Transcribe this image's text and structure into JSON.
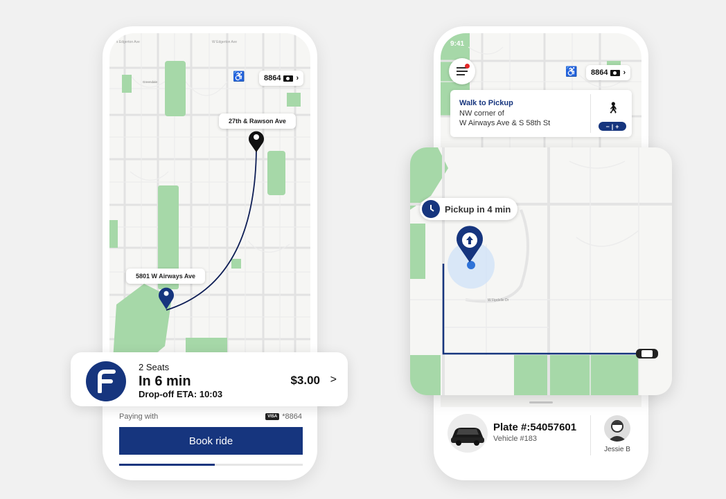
{
  "left_phone": {
    "map_top_labels": [
      "s Edgerton Ave",
      "W Edgerton Ave"
    ],
    "map_place": "Greendale",
    "balance": "8864",
    "destination_label": "27th & Rawson Ave",
    "origin_label": "5801 W Airways Ave",
    "ride": {
      "seats": "2 Seats",
      "eta": "In 6 min",
      "dropoff": "Drop-off ETA: 10:03",
      "price": "$3.00",
      "chevron": ">",
      "logo_letter": "F"
    },
    "paying_label": "Paying with",
    "card_brand": "VISA",
    "card_number": "*8864",
    "book_label": "Book ride",
    "progress_fraction": 0.52
  },
  "right_phone": {
    "status_time": "9:41",
    "balance": "8864",
    "walk": {
      "title": "Walk to Pickup",
      "line1": "NW corner of",
      "line2": "W Airways Ave & S 58th St",
      "zoom_minus": "−",
      "zoom_sep": "|",
      "zoom_plus": "+"
    },
    "pickup_text": "Pickup in 4 min",
    "street_label": "W Fipdelle Dr",
    "driver": {
      "plate": "Plate #:54057601",
      "vehicle": "Vehicle #183",
      "name": "Jessie B"
    }
  },
  "colors": {
    "brand": "#16357e",
    "park": "#a6d8a8",
    "alert": "#e32828"
  },
  "icons": [
    "accessibility-icon",
    "cash-icon",
    "target-icon",
    "menu-icon",
    "walking-icon",
    "clock-icon",
    "pickup-pin-icon",
    "car-icon",
    "avatar-icon"
  ]
}
